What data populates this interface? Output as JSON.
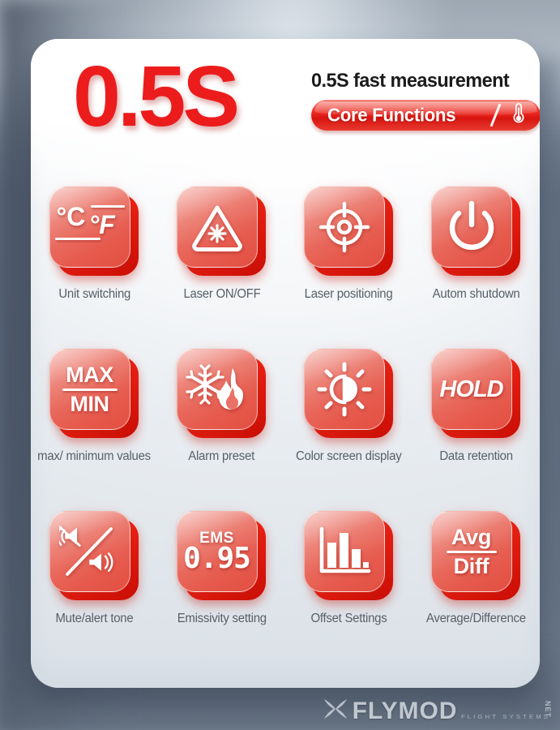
{
  "header": {
    "big_number": "0.5S",
    "tagline": "0.5S fast measurement",
    "pill_label": "Core Functions",
    "pill_icon": "thermometer-icon",
    "accent_color": "#ec1c1c",
    "tile_color": "#e65a4d",
    "label_color": "#575f66"
  },
  "features": [
    {
      "icon": "celsius-fahrenheit-icon",
      "label": "Unit switching",
      "icon_text": {
        "unit_c": "°C",
        "unit_f": "°F"
      }
    },
    {
      "icon": "laser-warning-triangle-icon",
      "label": "Laser ON/OFF"
    },
    {
      "icon": "crosshair-target-icon",
      "label": "Laser positioning"
    },
    {
      "icon": "power-icon",
      "label": "Autom shutdown"
    },
    {
      "icon": "max-min-icon",
      "label": "max/ minimum values",
      "icon_text": {
        "top": "MAX",
        "bottom": "MIN"
      }
    },
    {
      "icon": "snowflake-flame-icon",
      "label": "Alarm preset"
    },
    {
      "icon": "brightness-contrast-icon",
      "label": "Color screen display"
    },
    {
      "icon": "hold-icon",
      "label": "Data retention",
      "icon_text": {
        "word": "HOLD"
      }
    },
    {
      "icon": "mute-alert-speaker-icon",
      "label": "Mute/alert tone"
    },
    {
      "icon": "emissivity-icon",
      "label": "Emissivity setting",
      "icon_text": {
        "caption": "EMS",
        "value": "0.95"
      }
    },
    {
      "icon": "bar-chart-icon",
      "label": "Offset Settings"
    },
    {
      "icon": "avg-diff-icon",
      "label": "Average/Difference",
      "icon_text": {
        "top": "Avg",
        "bottom": "Diff"
      }
    }
  ],
  "watermark": {
    "brand": "FLYMOD",
    "suffix": "NET",
    "tagline": "FLIGHT SYSTEMS",
    "icon": "propeller-x-icon"
  }
}
